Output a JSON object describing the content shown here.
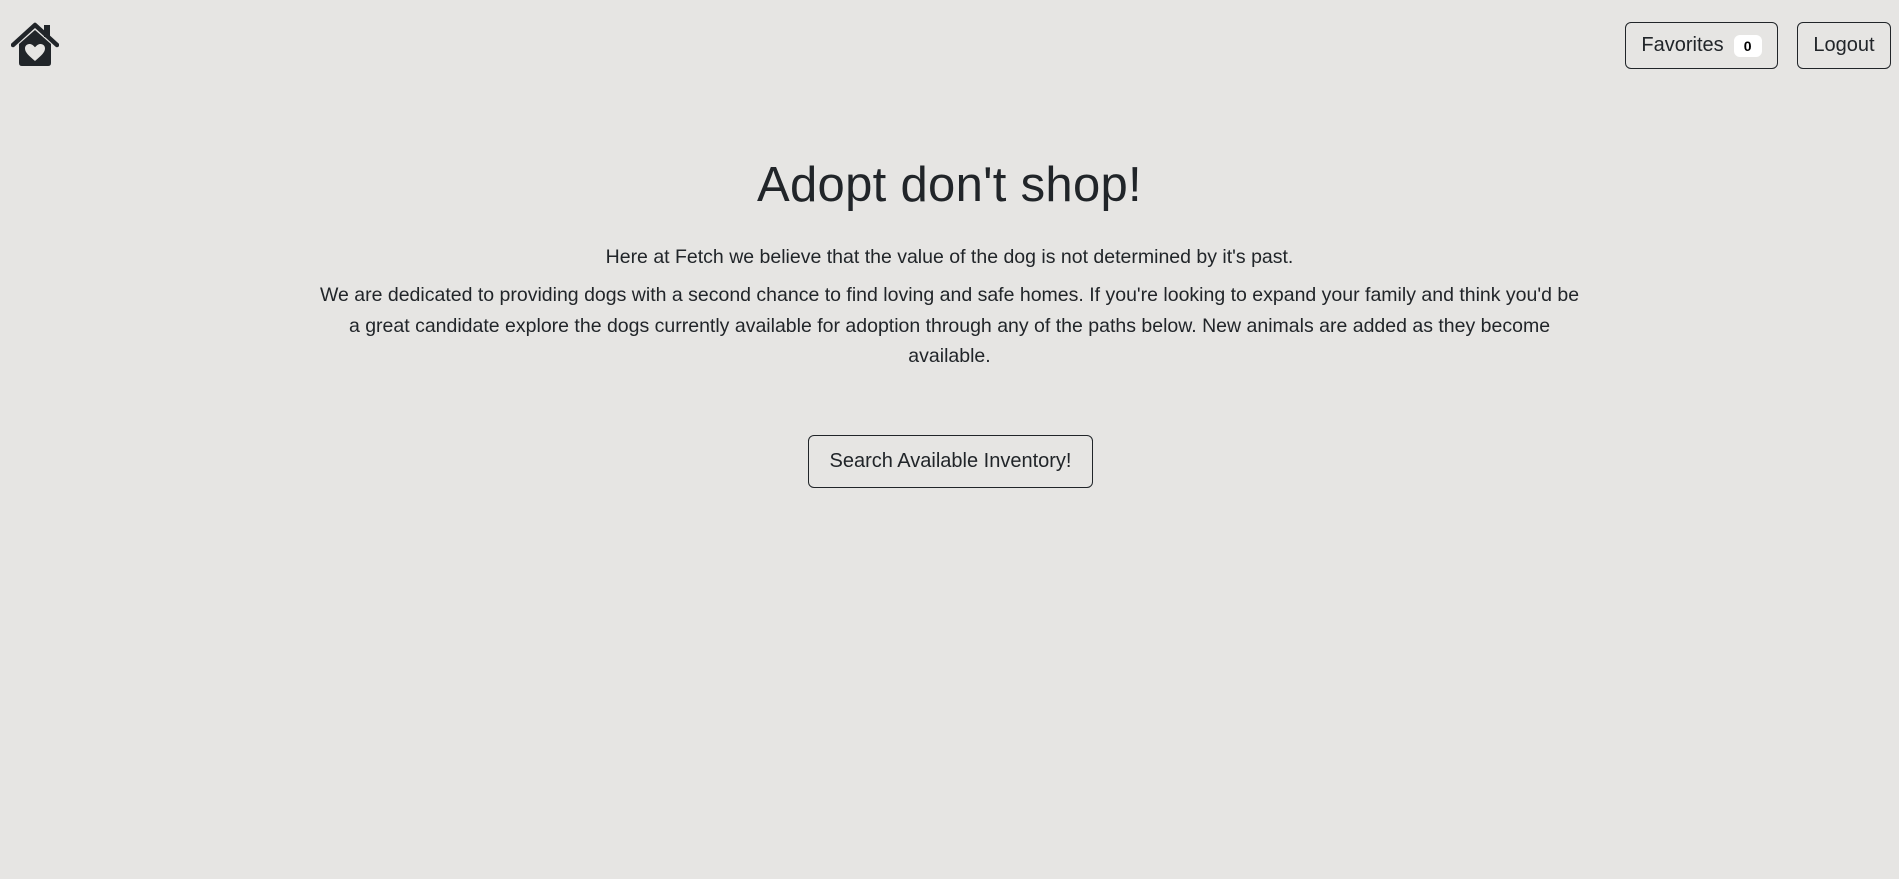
{
  "header": {
    "home_icon": "house-heart-icon",
    "favorites_label": "Favorites",
    "favorites_count": "0",
    "logout_label": "Logout"
  },
  "main": {
    "headline": "Adopt don't shop!",
    "tagline": "Here at Fetch we believe that the value of the dog is not determined by it's past.",
    "description": "We are dedicated to providing dogs with a second chance to find loving and safe homes. If you're looking to expand your family and think you'd be a great candidate explore the dogs currently available for adoption through any of the paths below. New animals are added as they become available.",
    "search_button_label": "Search Available Inventory!"
  },
  "colors": {
    "background": "#e6e5e3",
    "text": "#212529",
    "badge_bg": "#ffffff"
  }
}
